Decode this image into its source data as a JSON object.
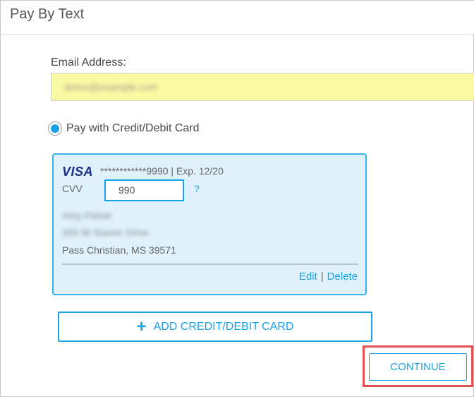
{
  "dialog": {
    "title": "Pay By Text"
  },
  "email": {
    "label": "Email Address:",
    "value": "demo@example.com"
  },
  "payment_option": {
    "label": "Pay with Credit/Debit Card",
    "selected": true
  },
  "card": {
    "brand": "VISA",
    "number_exp": "************9990  |  Exp. 12/20",
    "cvv_label": "CVV",
    "cvv_value": "990",
    "cvv_help": "?",
    "holder_name": "Amy Fisher",
    "street": "200 W Scenic Drive",
    "city_state_zip": "Pass Christian, MS 39571",
    "edit_label": "Edit",
    "separator": "|",
    "delete_label": "Delete"
  },
  "add_card": {
    "icon": "+",
    "label": "ADD CREDIT/DEBIT CARD"
  },
  "continue": {
    "label": "CONTINUE"
  },
  "colors": {
    "accent": "#1aa3e8",
    "email_fill": "#fafaa2",
    "card_bg": "#dff2fc",
    "highlight": "#e05252",
    "visa": "#1a2d8c"
  }
}
